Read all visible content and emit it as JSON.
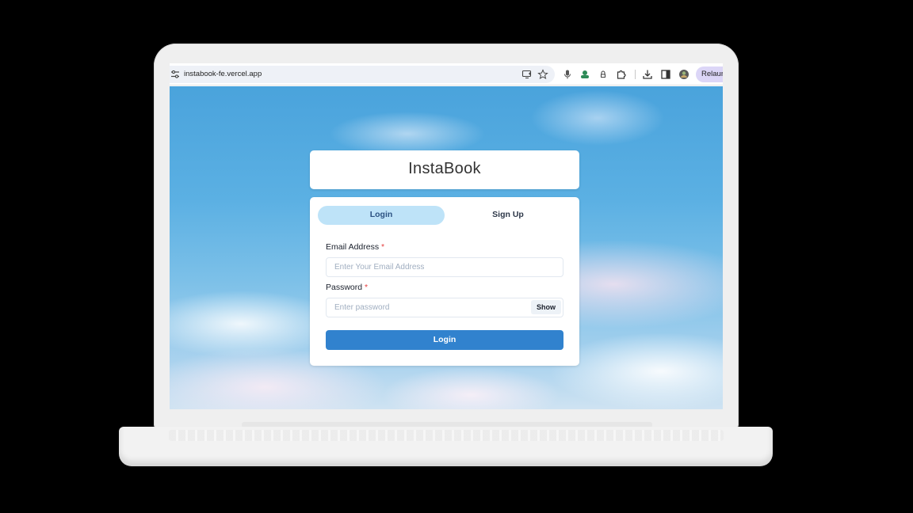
{
  "browser": {
    "url": "instabook-fe.vercel.app",
    "relaunch_label": "Relaunch",
    "icons": [
      "tune-icon",
      "install-app-icon",
      "star-icon",
      "microphone-icon",
      "extension-icon",
      "lock-icon",
      "puzzle-icon",
      "download-icon",
      "sidebar-icon",
      "profile-avatar-icon"
    ]
  },
  "app": {
    "title": "InstaBook"
  },
  "tabs": {
    "login": "Login",
    "signup": "Sign Up"
  },
  "form": {
    "email_label": "Email Address",
    "email_placeholder": "Enter Your Email Address",
    "password_label": "Password",
    "password_placeholder": "Enter password",
    "required_mark": "*",
    "show_label": "Show",
    "submit_label": "Login"
  },
  "colors": {
    "primary": "#3182ce",
    "tab_active_bg": "#bee3f8",
    "required": "#e53e3e"
  }
}
